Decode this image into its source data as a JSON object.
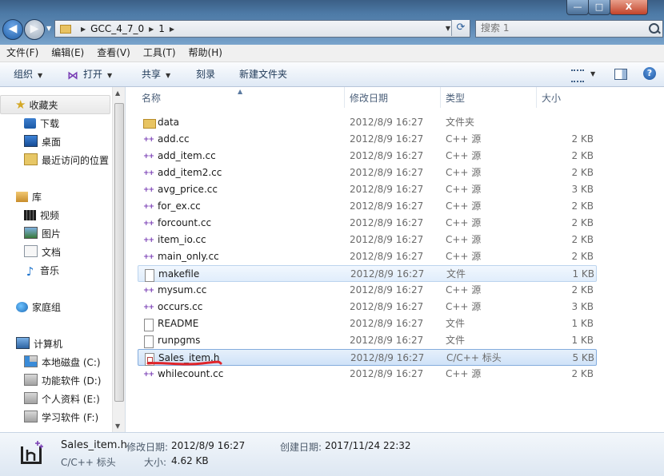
{
  "address": {
    "crumbs": [
      "GCC_4_7_0",
      "1"
    ],
    "search_placeholder": "搜索 1"
  },
  "window_buttons": {
    "minimize": "—",
    "maximize": "□",
    "close": "X"
  },
  "menu": [
    "文件(F)",
    "编辑(E)",
    "查看(V)",
    "工具(T)",
    "帮助(H)"
  ],
  "toolbar": {
    "organize": "组织",
    "open": "打开",
    "share": "共享",
    "burn": "刻录",
    "new_folder": "新建文件夹"
  },
  "nav": {
    "favorites": "收藏夹",
    "downloads": "下载",
    "desktop": "桌面",
    "recent": "最近访问的位置",
    "libraries": "库",
    "videos": "视频",
    "pictures": "图片",
    "documents": "文档",
    "music": "音乐",
    "homegroup": "家庭组",
    "computer": "计算机",
    "drive_c": "本地磁盘 (C:)",
    "drive_d": "功能软件 (D:)",
    "drive_e": "个人资料 (E:)",
    "drive_f": "学习软件 (F:)"
  },
  "columns": {
    "name": "名称",
    "modified": "修改日期",
    "type": "类型",
    "size": "大小"
  },
  "files": [
    {
      "name": "data",
      "date": "2012/8/9 16:27",
      "type": "文件夹",
      "size": "",
      "icon": "folder-icon"
    },
    {
      "name": "add.cc",
      "date": "2012/8/9 16:27",
      "type": "C++ 源",
      "size": "2 KB",
      "icon": "cpp-file-icon"
    },
    {
      "name": "add_item.cc",
      "date": "2012/8/9 16:27",
      "type": "C++ 源",
      "size": "2 KB",
      "icon": "cpp-file-icon"
    },
    {
      "name": "add_item2.cc",
      "date": "2012/8/9 16:27",
      "type": "C++ 源",
      "size": "2 KB",
      "icon": "cpp-file-icon"
    },
    {
      "name": "avg_price.cc",
      "date": "2012/8/9 16:27",
      "type": "C++ 源",
      "size": "3 KB",
      "icon": "cpp-file-icon"
    },
    {
      "name": "for_ex.cc",
      "date": "2012/8/9 16:27",
      "type": "C++ 源",
      "size": "2 KB",
      "icon": "cpp-file-icon"
    },
    {
      "name": "forcount.cc",
      "date": "2012/8/9 16:27",
      "type": "C++ 源",
      "size": "2 KB",
      "icon": "cpp-file-icon"
    },
    {
      "name": "item_io.cc",
      "date": "2012/8/9 16:27",
      "type": "C++ 源",
      "size": "2 KB",
      "icon": "cpp-file-icon"
    },
    {
      "name": "main_only.cc",
      "date": "2012/8/9 16:27",
      "type": "C++ 源",
      "size": "2 KB",
      "icon": "cpp-file-icon"
    },
    {
      "name": "makefile",
      "date": "2012/8/9 16:27",
      "type": "文件",
      "size": "1 KB",
      "icon": "plain-file-icon"
    },
    {
      "name": "mysum.cc",
      "date": "2012/8/9 16:27",
      "type": "C++ 源",
      "size": "2 KB",
      "icon": "cpp-file-icon"
    },
    {
      "name": "occurs.cc",
      "date": "2012/8/9 16:27",
      "type": "C++ 源",
      "size": "3 KB",
      "icon": "cpp-file-icon"
    },
    {
      "name": "README",
      "date": "2012/8/9 16:27",
      "type": "文件",
      "size": "1 KB",
      "icon": "plain-file-icon"
    },
    {
      "name": "runpgms",
      "date": "2012/8/9 16:27",
      "type": "文件",
      "size": "1 KB",
      "icon": "plain-file-icon"
    },
    {
      "name": "Sales_item.h",
      "date": "2012/8/9 16:27",
      "type": "C/C++ 标头",
      "size": "5 KB",
      "icon": "header-file-icon"
    },
    {
      "name": "whilecount.cc",
      "date": "2012/8/9 16:27",
      "type": "C++ 源",
      "size": "2 KB",
      "icon": "cpp-file-icon"
    }
  ],
  "details": {
    "name": "Sales_item.h",
    "type": "C/C++ 标头",
    "modified_label": "修改日期:",
    "modified_value": "2012/8/9 16:27",
    "created_label": "创建日期:",
    "created_value": "2017/11/24 22:32",
    "size_label": "大小:",
    "size_value": "4.62 KB",
    "icon_letters": "h++"
  },
  "colors": {
    "selection": "#cfe2f8",
    "underline_mark": "#e0242a",
    "cpp_icon": "#7a3fb5"
  }
}
